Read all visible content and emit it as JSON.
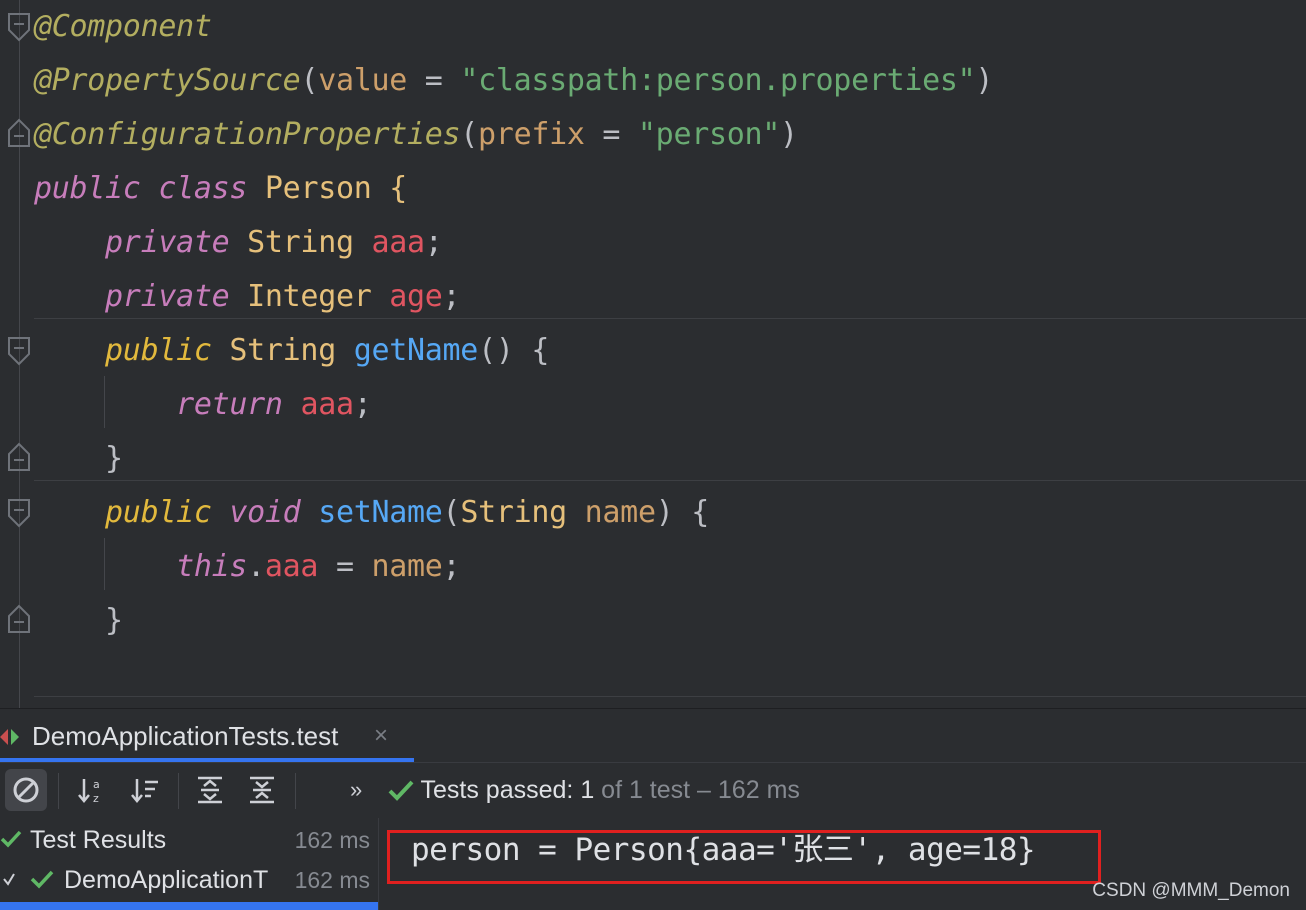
{
  "editor": {
    "lines": [
      {
        "tokens": [
          {
            "t": "@Component",
            "c": "ann"
          }
        ]
      },
      {
        "tokens": [
          {
            "t": "@PropertySource",
            "c": "ann"
          },
          {
            "t": "(",
            "c": ""
          },
          {
            "t": "value",
            "c": "prm"
          },
          {
            "t": " = ",
            "c": ""
          },
          {
            "t": "\"classpath:person.properties\"",
            "c": "str"
          },
          {
            "t": ")",
            "c": ""
          }
        ]
      },
      {
        "tokens": [
          {
            "t": "@ConfigurationProperties",
            "c": "ann"
          },
          {
            "t": "(",
            "c": ""
          },
          {
            "t": "prefix",
            "c": "prm"
          },
          {
            "t": " = ",
            "c": ""
          },
          {
            "t": "\"person\"",
            "c": "str"
          },
          {
            "t": ")",
            "c": ""
          }
        ]
      },
      {
        "tokens": [
          {
            "t": "public",
            "c": "fld-i"
          },
          {
            "t": " ",
            "c": ""
          },
          {
            "t": "class",
            "c": "fld-i"
          },
          {
            "t": " Person {",
            "c": "cls"
          }
        ]
      },
      {
        "tokens": [
          {
            "t": "    ",
            "c": ""
          },
          {
            "t": "private",
            "c": "fld-i"
          },
          {
            "t": " String ",
            "c": "cls"
          },
          {
            "t": "aaa",
            "c": "red"
          },
          {
            "t": ";",
            "c": ""
          }
        ]
      },
      {
        "tokens": [
          {
            "t": "    ",
            "c": ""
          },
          {
            "t": "private",
            "c": "fld-i"
          },
          {
            "t": " Integer ",
            "c": "cls"
          },
          {
            "t": "age",
            "c": "red"
          },
          {
            "t": ";",
            "c": ""
          }
        ]
      },
      {
        "tokens": [
          {
            "t": "    ",
            "c": ""
          },
          {
            "t": "public",
            "c": "ylw-i"
          },
          {
            "t": " String ",
            "c": "cls"
          },
          {
            "t": "getName",
            "c": "mth"
          },
          {
            "t": "() {",
            "c": ""
          }
        ]
      },
      {
        "tokens": [
          {
            "t": "        ",
            "c": ""
          },
          {
            "t": "return",
            "c": "fld-i"
          },
          {
            "t": " ",
            "c": ""
          },
          {
            "t": "aaa",
            "c": "red"
          },
          {
            "t": ";",
            "c": ""
          }
        ]
      },
      {
        "tokens": [
          {
            "t": "    }",
            "c": ""
          }
        ]
      },
      {
        "tokens": [
          {
            "t": "    ",
            "c": ""
          },
          {
            "t": "public",
            "c": "ylw-i"
          },
          {
            "t": " ",
            "c": ""
          },
          {
            "t": "void",
            "c": "fld-i"
          },
          {
            "t": " ",
            "c": ""
          },
          {
            "t": "setName",
            "c": "mth"
          },
          {
            "t": "(",
            "c": ""
          },
          {
            "t": "String",
            "c": "cls"
          },
          {
            "t": " ",
            "c": ""
          },
          {
            "t": "name",
            "c": "prm"
          },
          {
            "t": ") {",
            "c": ""
          }
        ]
      },
      {
        "tokens": [
          {
            "t": "        ",
            "c": ""
          },
          {
            "t": "this",
            "c": "fld-i"
          },
          {
            "t": ".",
            "c": ""
          },
          {
            "t": "aaa",
            "c": "red"
          },
          {
            "t": " = ",
            "c": ""
          },
          {
            "t": "name",
            "c": "prm"
          },
          {
            "t": ";",
            "c": ""
          }
        ]
      },
      {
        "tokens": [
          {
            "t": "    }",
            "c": ""
          }
        ]
      }
    ]
  },
  "run_panel": {
    "tab_label": "DemoApplicationTests.test",
    "tab_close": "×",
    "toolbar": {
      "more": "»",
      "status_prefix": "Tests passed: ",
      "status_count": "1",
      "status_of": " of 1 test",
      "status_dash": " – ",
      "status_time": "162 ms"
    },
    "tree": [
      {
        "label": "Test Results",
        "time": "162 ms"
      },
      {
        "label": "DemoApplicationT",
        "time": "162 ms"
      }
    ],
    "console": {
      "output": "person = Person{aaa='张三', age=18}"
    }
  },
  "watermark": "CSDN @MMM_Demon",
  "colors": {
    "accent": "#3574f0",
    "pass_green": "#5fb865",
    "highlight_red": "#e0201f"
  },
  "icons": [
    "stop-icon",
    "sort-alpha-icon",
    "sort-duration-icon",
    "expand-all-icon",
    "collapse-all-icon",
    "check-icon",
    "run-config-icon"
  ]
}
